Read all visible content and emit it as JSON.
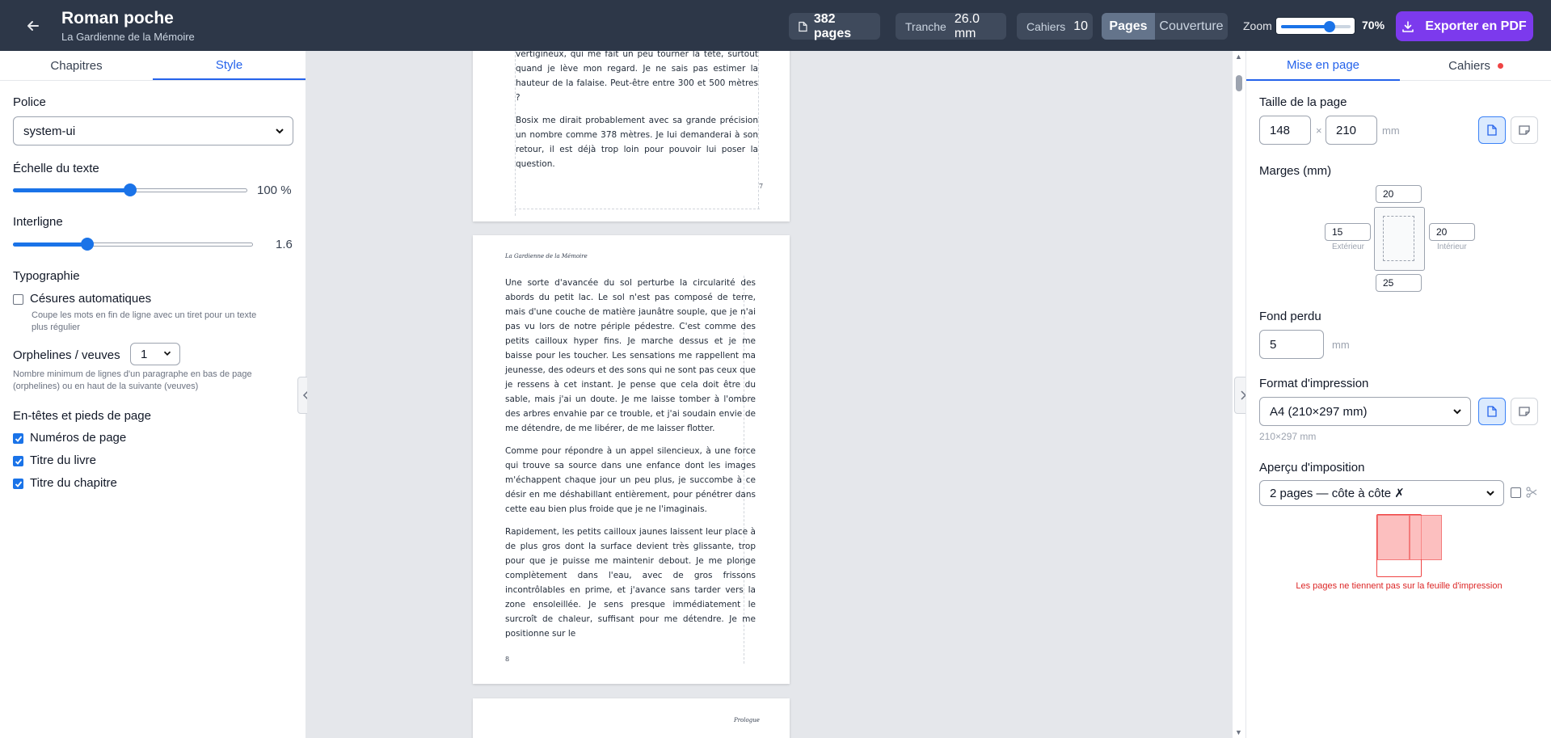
{
  "header": {
    "title": "Roman poche",
    "subtitle": "La Gardienne de la Mémoire",
    "pages_value": "382 pages",
    "tranche_label": "Tranche",
    "tranche_value": "26.0 mm",
    "cahiers_label": "Cahiers",
    "cahiers_value": "10",
    "view_pages": "Pages",
    "view_cover": "Couverture",
    "zoom_label": "Zoom",
    "zoom_value": "70%",
    "zoom_fraction": 0.7,
    "export_label": "Exporter en PDF"
  },
  "left": {
    "tabs": [
      "Chapitres",
      "Style"
    ],
    "font_label": "Police",
    "font_value": "system-ui",
    "scale_label": "Échelle du texte",
    "scale_value": "100 %",
    "scale_fraction": 0.5,
    "line_label": "Interligne",
    "line_value": "1.6",
    "line_fraction": 0.31,
    "typo_label": "Typographie",
    "hyphen_label": "Césures automatiques",
    "hyphen_help": "Coupe les mots en fin de ligne avec un tiret pour un texte plus régulier",
    "orphans_label": "Orphelines / veuves",
    "orphans_value": "1",
    "orphans_help": "Nombre minimum de lignes d'un paragraphe en bas de page (orphelines) ou en haut de la suivante (veuves)",
    "headers_label": "En-têtes et pieds de page",
    "check_page_numbers": "Numéros de page",
    "check_book_title": "Titre du livre",
    "check_chapter_title": "Titre du chapitre"
  },
  "pages": {
    "page7_paragraphs": [
      "vertigineux, qui me fait un peu tourner la tête, surtout quand je lève mon regard. Je ne sais pas estimer la hauteur de la falaise. Peut-être entre 300 et 500 mètres ?",
      "Bosix me dirait probablement avec sa grande précision un nombre comme 378 mètres. Je lui demanderai à son retour, il est déjà trop loin pour pouvoir lui poser la question."
    ],
    "page7_number": "7",
    "page8_running_head": "La Gardienne de la Mémoire",
    "page8_paragraphs": [
      "Une sorte d'avancée du sol perturbe la circularité des abords du petit lac. Le sol n'est pas composé de terre, mais d'une couche de matière jaunâtre souple, que je n'ai pas vu lors de notre périple pédestre. C'est comme des petits cailloux hyper fins. Je marche dessus et je me baisse pour les toucher. Les sensations me rappellent ma jeunesse, des odeurs et des sons qui ne sont pas ceux que je ressens à cet instant. Je pense que cela doit être du sable, mais j'ai un doute. Je me laisse tomber à l'ombre des arbres envahie par ce trouble, et j'ai soudain envie de me détendre, de me libérer, de me laisser flotter.",
      "Comme pour répondre à un appel silencieux, à une force qui trouve sa source dans une enfance dont les images m'échappent chaque jour un peu plus, je succombe à ce désir en me déshabillant entièrement, pour pénétrer dans cette eau bien plus froide que je ne l'imaginais.",
      "Rapidement, les petits cailloux jaunes laissent leur place à de plus gros dont la surface devient très glissante, trop pour que je puisse me maintenir debout. Je me plonge complètement dans l'eau, avec de gros frissons incontrôlables en prime, et j'avance sans tarder vers la zone ensoleillée. Je sens presque immédiatement le surcroît de chaleur, suffisant pour me détendre. Je me positionne sur le"
    ],
    "page8_number": "8",
    "page9_running_head": "Prologue"
  },
  "right": {
    "tabs": [
      "Mise en page",
      "Cahiers"
    ],
    "page_size_label": "Taille de la page",
    "width_value": "148",
    "times": "×",
    "height_value": "210",
    "unit_mm": "mm",
    "margins_label": "Marges (mm)",
    "margin_top": "20",
    "margin_left": "15",
    "margin_left_label": "Extérieur",
    "margin_right": "20",
    "margin_right_label": "Intérieur",
    "margin_bottom": "25",
    "bleed_label": "Fond perdu",
    "bleed_value": "5",
    "print_format_label": "Format d'impression",
    "print_format_value": "A4 (210×297 mm)",
    "print_format_dims": "210×297 mm",
    "imposition_label": "Aperçu d'imposition",
    "imposition_value": "2 pages — côte à côte ✗",
    "warning": "Les pages ne tiennent pas sur la feuille d'impression",
    "accent_warning": "#dc2626"
  }
}
